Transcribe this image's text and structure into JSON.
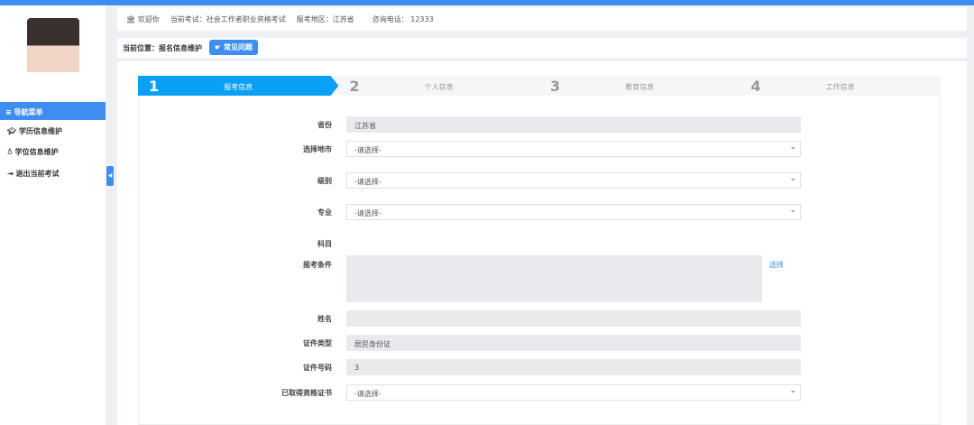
{
  "header": {
    "welcome": "欢迎你",
    "exam": "当前考试：社会工作者职业资格考试",
    "region": "报考地区：江苏省",
    "phone": "咨询电话： 12333"
  },
  "breadcrumb": {
    "label": "当前位置：报名信息维护",
    "faq": "常见问题"
  },
  "sidebar": {
    "title": "≡ 导航菜单",
    "items": [
      {
        "icon": "graduation-cap-icon",
        "label": "学历信息维护"
      },
      {
        "icon": "medal-icon",
        "label": "学位信息维护"
      },
      {
        "icon": "sign-out-icon",
        "label": "退出当前考试"
      }
    ]
  },
  "steps": [
    {
      "n": "1",
      "label": "报考信息"
    },
    {
      "n": "2",
      "label": "个人信息"
    },
    {
      "n": "3",
      "label": "教育信息"
    },
    {
      "n": "4",
      "label": "工作信息"
    }
  ],
  "form": {
    "province": {
      "label": "省份",
      "value": "江苏省"
    },
    "city": {
      "label": "选择地市",
      "value": "-请选择-"
    },
    "level": {
      "label": "级别",
      "value": "-请选择-"
    },
    "major": {
      "label": "专业",
      "value": "-请选择-"
    },
    "subject": {
      "label": "科目"
    },
    "condition": {
      "label": "报考条件",
      "link": "选择"
    },
    "name": {
      "label": "姓名",
      "value": ""
    },
    "id_type": {
      "label": "证件类型",
      "value": "居民身份证"
    },
    "id_no": {
      "label": "证件号码",
      "value": "3"
    },
    "cert": {
      "label": "已取得资格证书",
      "value": "-请选择-"
    }
  }
}
